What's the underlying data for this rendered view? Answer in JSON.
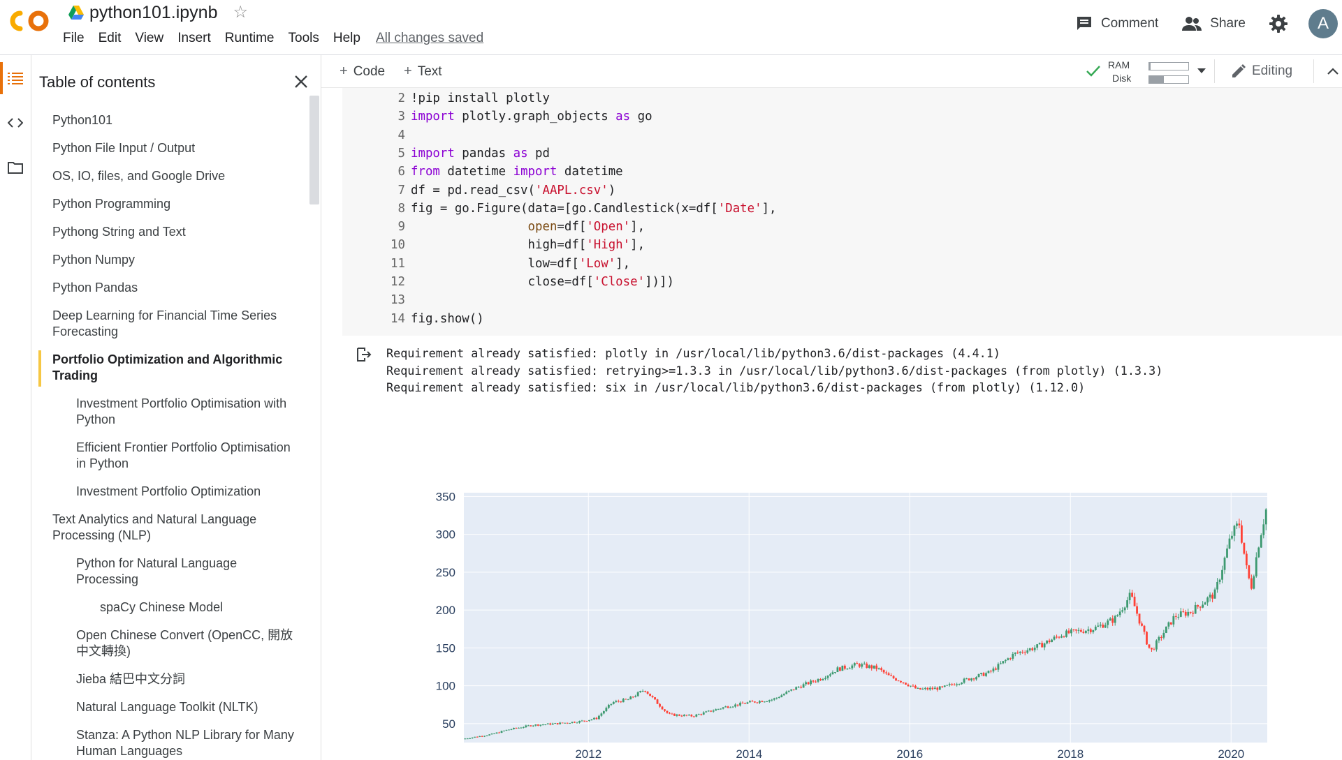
{
  "header": {
    "title": "python101.ipynb",
    "menu": [
      "File",
      "Edit",
      "View",
      "Insert",
      "Runtime",
      "Tools",
      "Help"
    ],
    "saved_status": "All changes saved",
    "comment_label": "Comment",
    "share_label": "Share",
    "avatar_letter": "A"
  },
  "toc": {
    "title": "Table of contents",
    "items": [
      {
        "level": 1,
        "label": "Python101"
      },
      {
        "level": 1,
        "label": "Python File Input / Output"
      },
      {
        "level": 1,
        "label": "OS, IO, files, and Google Drive"
      },
      {
        "level": 1,
        "label": "Python Programming"
      },
      {
        "level": 1,
        "label": "Pythong String and Text"
      },
      {
        "level": 1,
        "label": "Python Numpy"
      },
      {
        "level": 1,
        "label": "Python Pandas"
      },
      {
        "level": 1,
        "label": "Deep Learning for Financial Time Series Forecasting"
      },
      {
        "level": 1,
        "label": "Portfolio Optimization and Algorithmic Trading",
        "active": true
      },
      {
        "level": 2,
        "label": "Investment Portfolio Optimisation with Python"
      },
      {
        "level": 2,
        "label": "Efficient Frontier Portfolio Optimisation in Python"
      },
      {
        "level": 2,
        "label": "Investment Portfolio Optimization"
      },
      {
        "level": 1,
        "label": "Text Analytics and Natural Language Processing (NLP)"
      },
      {
        "level": 2,
        "label": "Python for Natural Language Processing"
      },
      {
        "level": 3,
        "label": "spaCy Chinese Model"
      },
      {
        "level": 2,
        "label": "Open Chinese Convert (OpenCC, 開放中文轉換)"
      },
      {
        "level": 2,
        "label": "Jieba 結巴中文分詞"
      },
      {
        "level": 2,
        "label": "Natural Language Toolkit (NLTK)"
      },
      {
        "level": 2,
        "label": "Stanza: A Python NLP Library for Many Human Languages"
      }
    ]
  },
  "toolbar": {
    "code_label": "Code",
    "text_label": "Text",
    "ram_label": "RAM",
    "disk_label": "Disk",
    "ram_usage": 0.03,
    "disk_usage": 0.38,
    "editing_label": "Editing"
  },
  "code_cell": {
    "lines": [
      {
        "n": "2",
        "parts": [
          [
            "t",
            "!pip install plotly"
          ]
        ]
      },
      {
        "n": "3",
        "parts": [
          [
            "k",
            "import"
          ],
          [
            "t",
            " plotly.graph_objects "
          ],
          [
            "k",
            "as"
          ],
          [
            "t",
            " go"
          ]
        ]
      },
      {
        "n": "4",
        "parts": []
      },
      {
        "n": "5",
        "parts": [
          [
            "k",
            "import"
          ],
          [
            "t",
            " pandas "
          ],
          [
            "k",
            "as"
          ],
          [
            "t",
            " pd"
          ]
        ]
      },
      {
        "n": "6",
        "parts": [
          [
            "k",
            "from"
          ],
          [
            "t",
            " datetime "
          ],
          [
            "k",
            "import"
          ],
          [
            "t",
            " datetime"
          ]
        ]
      },
      {
        "n": "7",
        "parts": [
          [
            "t",
            "df = pd.read_csv("
          ],
          [
            "s",
            "'AAPL.csv'"
          ],
          [
            "t",
            ")"
          ]
        ]
      },
      {
        "n": "8",
        "parts": [
          [
            "t",
            "fig = go.Figure(data=[go.Candlestick(x=df["
          ],
          [
            "s",
            "'Date'"
          ],
          [
            "t",
            "],"
          ]
        ]
      },
      {
        "n": "9",
        "parts": [
          [
            "t",
            "                "
          ],
          [
            "p",
            "open"
          ],
          [
            "t",
            "=df["
          ],
          [
            "s",
            "'Open'"
          ],
          [
            "t",
            "],"
          ]
        ]
      },
      {
        "n": "10",
        "parts": [
          [
            "t",
            "                high=df["
          ],
          [
            "s",
            "'High'"
          ],
          [
            "t",
            "],"
          ]
        ]
      },
      {
        "n": "11",
        "parts": [
          [
            "t",
            "                low=df["
          ],
          [
            "s",
            "'Low'"
          ],
          [
            "t",
            "],"
          ]
        ]
      },
      {
        "n": "12",
        "parts": [
          [
            "t",
            "                close=df["
          ],
          [
            "s",
            "'Close'"
          ],
          [
            "t",
            "])])"
          ]
        ]
      },
      {
        "n": "13",
        "parts": []
      },
      {
        "n": "14",
        "parts": [
          [
            "t",
            "fig.show()"
          ]
        ]
      }
    ]
  },
  "output": {
    "lines": [
      "Requirement already satisfied: plotly in /usr/local/lib/python3.6/dist-packages (4.4.1)",
      "Requirement already satisfied: retrying>=1.3.3 in /usr/local/lib/python3.6/dist-packages (from plotly) (1.3.3)",
      "Requirement already satisfied: six in /usr/local/lib/python3.6/dist-packages (from plotly) (1.12.0)"
    ]
  },
  "chart_data": {
    "type": "candlestick",
    "title": "",
    "xlabel": "",
    "ylabel": "",
    "x_ticks": [
      "2012",
      "2014",
      "2016",
      "2018",
      "2020"
    ],
    "x_tick_values": [
      2012.0,
      2014.0,
      2016.0,
      2018.0,
      2020.0
    ],
    "y_ticks": [
      50,
      100,
      150,
      200,
      250,
      300,
      350
    ],
    "xlim": [
      2010.45,
      2020.45
    ],
    "ylim": [
      25,
      355
    ],
    "grid": true,
    "colors": {
      "increasing": "#3d9970",
      "decreasing": "#ff4136",
      "plot_bg": "#e5ecf6",
      "grid": "#ffffff"
    },
    "approx_close_series": {
      "x": [
        2010.45,
        2010.8,
        2011.0,
        2011.3,
        2011.6,
        2011.9,
        2012.1,
        2012.3,
        2012.5,
        2012.7,
        2012.85,
        2013.0,
        2013.3,
        2013.5,
        2013.7,
        2014.0,
        2014.3,
        2014.6,
        2014.9,
        2015.1,
        2015.35,
        2015.6,
        2015.75,
        2015.9,
        2016.1,
        2016.4,
        2016.7,
        2017.0,
        2017.3,
        2017.6,
        2017.9,
        2018.1,
        2018.3,
        2018.55,
        2018.75,
        2018.95,
        2019.0,
        2019.3,
        2019.5,
        2019.8,
        2020.0,
        2020.1,
        2020.2,
        2020.25,
        2020.35,
        2020.45
      ],
      "close": [
        30,
        36,
        42,
        48,
        50,
        53,
        57,
        78,
        82,
        95,
        78,
        62,
        60,
        66,
        72,
        78,
        82,
        98,
        110,
        122,
        128,
        123,
        112,
        106,
        95,
        97,
        108,
        118,
        142,
        152,
        168,
        172,
        176,
        188,
        220,
        158,
        145,
        192,
        198,
        222,
        298,
        315,
        250,
        230,
        292,
        340
      ]
    }
  }
}
